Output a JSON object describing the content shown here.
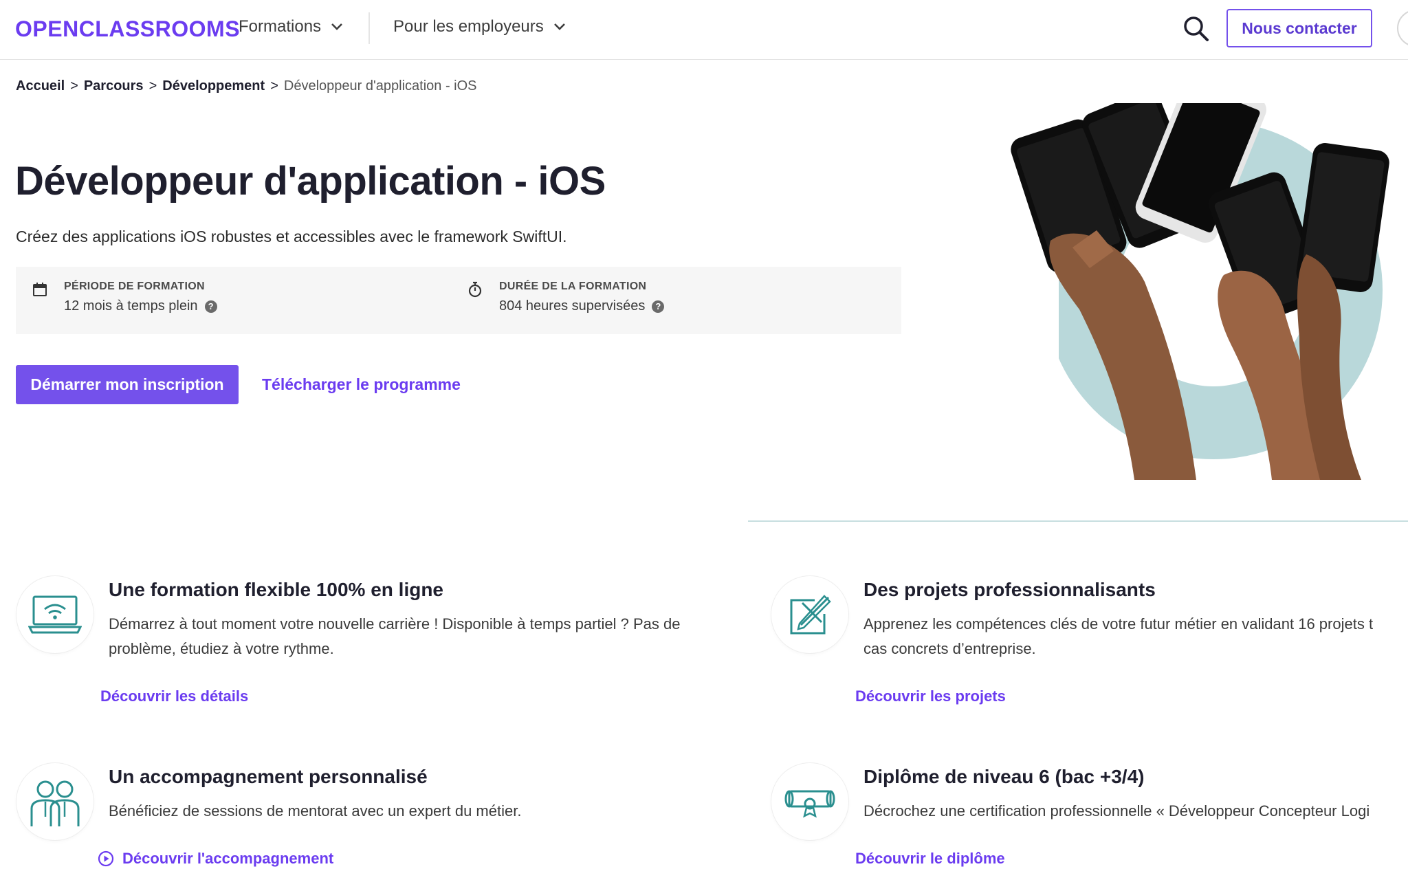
{
  "header": {
    "logo": "OPENCLASSROOMS",
    "nav": [
      {
        "label": "Formations"
      },
      {
        "label": "Pour les employeurs"
      }
    ],
    "contact_label": "Nous contacter"
  },
  "breadcrumb": {
    "items": [
      "Accueil",
      "Parcours",
      "Développement"
    ],
    "separator": ">",
    "current": "Développeur d'application - iOS"
  },
  "hero": {
    "title": "Développeur d'application - iOS",
    "subtitle": "Créez des applications iOS robustes et accessibles avec le framework SwiftUI.",
    "period": {
      "label": "PÉRIODE DE FORMATION",
      "value": "12 mois à temps plein"
    },
    "duration": {
      "label": "DURÉE DE LA FORMATION",
      "value": "804 heures supervisées"
    },
    "help_glyph": "?",
    "primary_button": "Démarrer mon inscription",
    "secondary_link": "Télécharger le programme"
  },
  "features": [
    {
      "icon": "laptop-wifi-icon",
      "title": "Une formation flexible 100% en ligne",
      "desc_lines": [
        "Démarrez à tout moment votre nouvelle carrière ! Disponible à temps partiel ? Pas de",
        "problème, étudiez à votre rythme."
      ],
      "link": "Découvrir les détails"
    },
    {
      "icon": "design-tools-icon",
      "title": "Des projets professionnalisants",
      "desc_lines": [
        "Apprenez les compétences clés de votre futur métier en validant 16 projets t",
        "cas concrets d’entreprise."
      ],
      "link": "Découvrir les projets"
    },
    {
      "icon": "mentors-icon",
      "title": "Un accompagnement personnalisé",
      "desc_lines": [
        "Bénéficiez de sessions de mentorat avec un expert du métier."
      ],
      "link": "Découvrir l'accompagnement"
    },
    {
      "icon": "diploma-icon",
      "title": "Diplôme de niveau 6 (bac +3/4)",
      "desc_lines": [
        "Décrochez une certification professionnelle « Développeur Concepteur Logi"
      ],
      "link": "Découvrir le diplôme"
    }
  ],
  "colors": {
    "brand": "#6b3cf0",
    "button": "#7451eb",
    "teal": "#2a8f8f",
    "hero_ring": "#b9d8da"
  }
}
